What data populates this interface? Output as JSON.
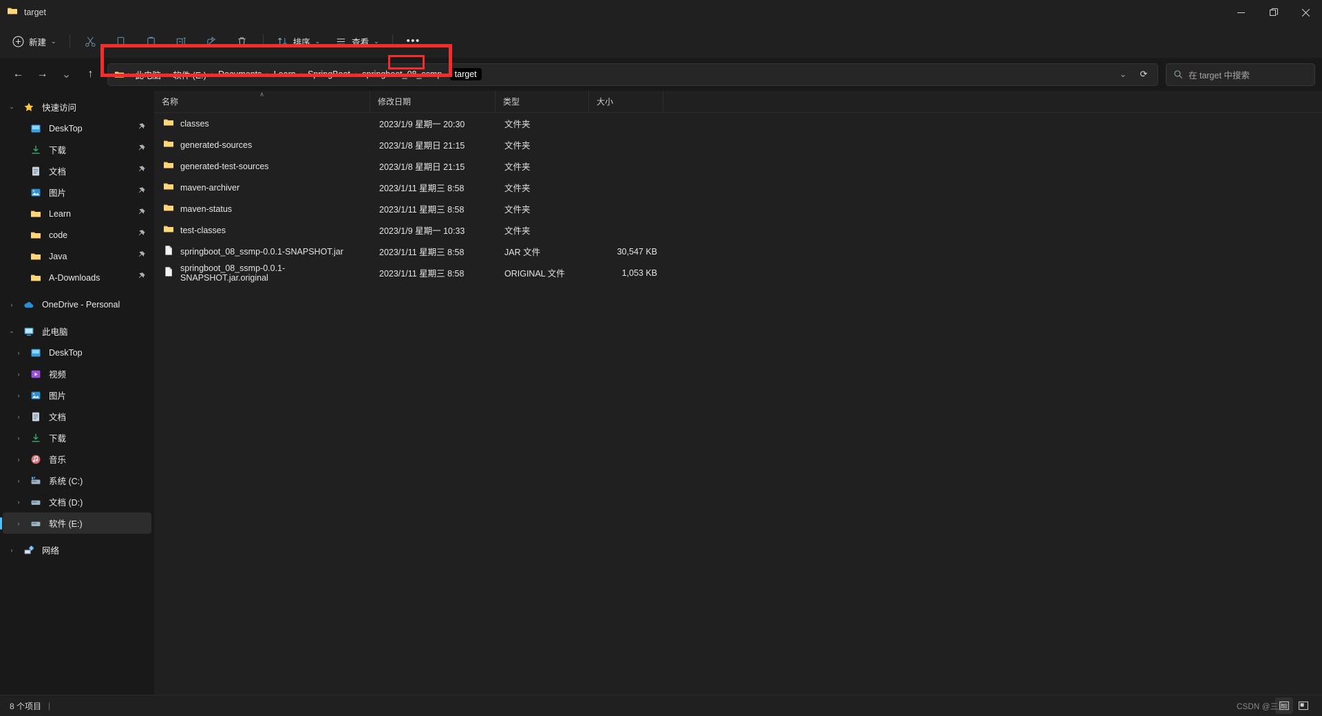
{
  "window": {
    "title": "target",
    "folder_icon": "folder-icon",
    "controls": {
      "minimize": "—",
      "restore": "❐",
      "close": "✕"
    }
  },
  "toolbar": {
    "new_label": "新建",
    "chevron": "⌄",
    "items": [
      {
        "name": "cut-button",
        "icon": "scissors-icon"
      },
      {
        "name": "copy-button",
        "icon": "copy-icon"
      },
      {
        "name": "paste-button",
        "icon": "paste-icon"
      },
      {
        "name": "rename-button",
        "icon": "rename-icon"
      },
      {
        "name": "share-button",
        "icon": "share-icon"
      },
      {
        "name": "delete-button",
        "icon": "trash-icon"
      }
    ],
    "sort_label": "排序",
    "view_label": "查看",
    "more_label": "•••"
  },
  "navigation": {
    "back": "←",
    "forward": "→",
    "recent": "⌄",
    "up": "↑",
    "dropdown": "⌄",
    "refresh": "⟳"
  },
  "breadcrumb": {
    "separator": "›",
    "items": [
      "此电脑",
      "软件 (E:)",
      "Documents",
      "Learn",
      "SpringBoot",
      "springboot_08_ssmp",
      "target"
    ]
  },
  "search": {
    "placeholder": "在 target 中搜索",
    "icon": "search-icon"
  },
  "sidebar": {
    "quick_access": {
      "label": "快速访问",
      "icon": "star-icon",
      "expanded": true,
      "twisty": "⌄",
      "items": [
        {
          "label": "DeskTop",
          "icon": "desktop-icon",
          "pinned": true
        },
        {
          "label": "下载",
          "icon": "download-icon",
          "pinned": true
        },
        {
          "label": "文档",
          "icon": "documents-icon",
          "pinned": true
        },
        {
          "label": "图片",
          "icon": "pictures-icon",
          "pinned": true
        },
        {
          "label": "Learn",
          "icon": "folder-icon",
          "pinned": true
        },
        {
          "label": "code",
          "icon": "folder-icon",
          "pinned": true
        },
        {
          "label": "Java",
          "icon": "folder-icon",
          "pinned": true
        },
        {
          "label": "A-Downloads",
          "icon": "folder-icon",
          "pinned": true
        }
      ]
    },
    "onedrive": {
      "label": "OneDrive - Personal",
      "icon": "cloud-icon",
      "twisty": "›"
    },
    "this_pc": {
      "label": "此电脑",
      "icon": "pc-icon",
      "twisty": "⌄",
      "items": [
        {
          "label": "DeskTop",
          "icon": "desktop-icon",
          "selected": false
        },
        {
          "label": "视频",
          "icon": "videos-icon",
          "selected": false
        },
        {
          "label": "图片",
          "icon": "pictures-icon",
          "selected": false
        },
        {
          "label": "文档",
          "icon": "documents-icon",
          "selected": false
        },
        {
          "label": "下载",
          "icon": "download-icon",
          "selected": false
        },
        {
          "label": "音乐",
          "icon": "music-icon",
          "selected": false
        },
        {
          "label": "系统 (C:)",
          "icon": "os-drive-icon",
          "selected": false
        },
        {
          "label": "文档 (D:)",
          "icon": "drive-icon",
          "selected": false
        },
        {
          "label": "软件 (E:)",
          "icon": "drive-icon",
          "selected": true
        }
      ]
    },
    "network": {
      "label": "网络",
      "icon": "network-icon",
      "twisty": "›"
    }
  },
  "columns": {
    "sort_caret": "∧",
    "headers": [
      "名称",
      "修改日期",
      "类型",
      "大小"
    ]
  },
  "files": [
    {
      "name": "classes",
      "date": "2023/1/9 星期一 20:30",
      "type": "文件夹",
      "size": "",
      "icon": "folder-icon"
    },
    {
      "name": "generated-sources",
      "date": "2023/1/8 星期日 21:15",
      "type": "文件夹",
      "size": "",
      "icon": "folder-icon"
    },
    {
      "name": "generated-test-sources",
      "date": "2023/1/8 星期日 21:15",
      "type": "文件夹",
      "size": "",
      "icon": "folder-icon"
    },
    {
      "name": "maven-archiver",
      "date": "2023/1/11 星期三 8:58",
      "type": "文件夹",
      "size": "",
      "icon": "folder-icon"
    },
    {
      "name": "maven-status",
      "date": "2023/1/11 星期三 8:58",
      "type": "文件夹",
      "size": "",
      "icon": "folder-icon"
    },
    {
      "name": "test-classes",
      "date": "2023/1/9 星期一 10:33",
      "type": "文件夹",
      "size": "",
      "icon": "folder-icon"
    },
    {
      "name": "springboot_08_ssmp-0.0.1-SNAPSHOT.jar",
      "date": "2023/1/11 星期三 8:58",
      "type": "JAR 文件",
      "size": "30,547 KB",
      "icon": "file-icon"
    },
    {
      "name": "springboot_08_ssmp-0.0.1-SNAPSHOT.jar.original",
      "date": "2023/1/11 星期三 8:58",
      "type": "ORIGINAL 文件",
      "size": "1,053 KB",
      "icon": "file-icon"
    }
  ],
  "status": {
    "item_count": "8 个项目",
    "separator": "|",
    "watermark": "CSDN @三九",
    "view_details_icon": "details-view-icon",
    "view_large_icon": "large-icons-view-icon"
  },
  "annotations": {
    "accent": "#f42c2c",
    "boxes": [
      {
        "name": "breadcrumb-highlight-box",
        "target": "address-bar"
      },
      {
        "name": "target-crumb-highlight-box",
        "target": "breadcrumb-item-target"
      }
    ]
  }
}
